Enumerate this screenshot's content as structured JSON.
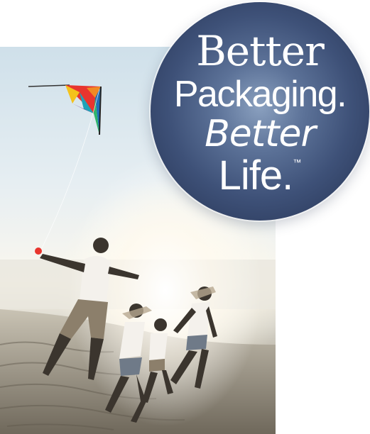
{
  "logo": {
    "line1": "Better",
    "line2": "Packaging.",
    "line3": "Better",
    "line4": "Life.",
    "trademark": "™"
  },
  "colors": {
    "badge_dark": "#263353",
    "badge_mid": "#3e5178",
    "badge_light": "#8aa0bf",
    "kite_red": "#e8352e",
    "kite_yellow": "#f4c21c",
    "kite_teal": "#1ea3b8",
    "kite_purple": "#7a3c8e"
  }
}
